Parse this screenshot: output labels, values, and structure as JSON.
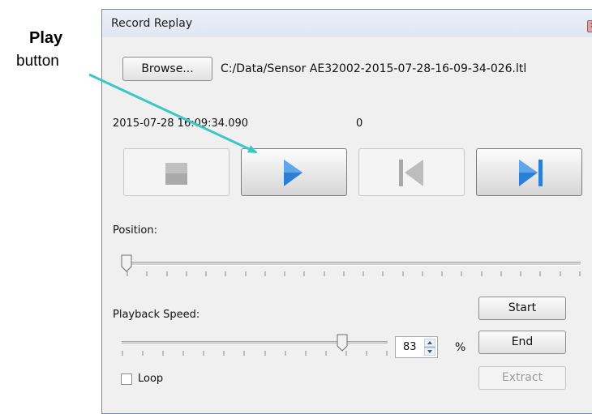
{
  "annotation": {
    "bold": "Play",
    "text": "button"
  },
  "window": {
    "title": "Record Replay"
  },
  "file": {
    "browse_label": "Browse...",
    "path": "C:/Data/Sensor AE32002-2015-07-28-16-09-34-026.ltl"
  },
  "status": {
    "timestamp": "2015-07-28 16:09:34.090",
    "counter": "0"
  },
  "controls": {
    "stop": {
      "enabled": false
    },
    "play": {
      "enabled": true
    },
    "step_back": {
      "enabled": false
    },
    "step_forward": {
      "enabled": true
    }
  },
  "position": {
    "label": "Position:",
    "value": 0
  },
  "speed": {
    "label": "Playback Speed:",
    "value": 83,
    "unit": "%"
  },
  "side_buttons": {
    "start": "Start",
    "end": "End",
    "extract": "Extract"
  },
  "loop": {
    "label": "Loop",
    "checked": false
  },
  "colors": {
    "accent_blue": "#2c7fd6",
    "arrow_teal": "#3cc6c6"
  }
}
